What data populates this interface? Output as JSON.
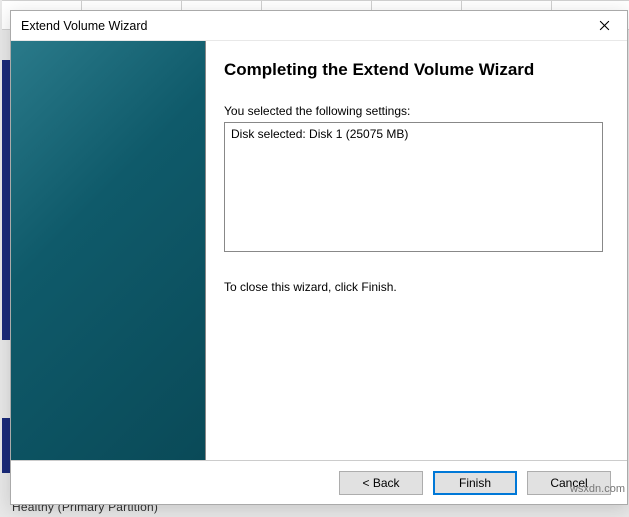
{
  "window": {
    "title": "Extend Volume Wizard"
  },
  "content": {
    "heading": "Completing the Extend Volume Wizard",
    "settings_label": "You selected the following settings:",
    "settings_value": "Disk selected: Disk 1 (25075 MB)",
    "instruction": "To close this wizard, click Finish."
  },
  "buttons": {
    "back": "< Back",
    "finish": "Finish",
    "cancel": "Cancel"
  },
  "watermark": "wsxdn.com",
  "bg_partition": "Healthy (Primary Partition)"
}
